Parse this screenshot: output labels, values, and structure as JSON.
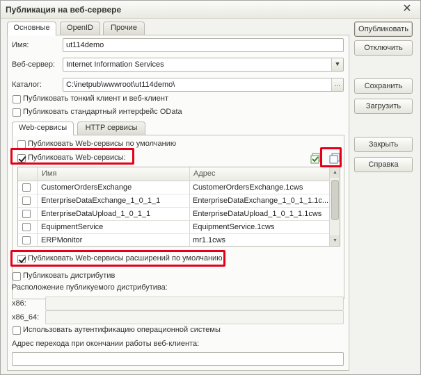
{
  "window": {
    "title": "Публикация на веб-сервере",
    "close_icon": "close-icon"
  },
  "tabs": [
    {
      "label": "Основные",
      "active": true
    },
    {
      "label": "OpenID",
      "active": false
    },
    {
      "label": "Прочие",
      "active": false
    }
  ],
  "form": {
    "name_label": "Имя:",
    "name_value": "ut114demo",
    "webserver_label": "Веб-сервер:",
    "webserver_value": "Internet Information Services",
    "catalog_label": "Каталог:",
    "catalog_value": "C:\\inetpub\\wwwroot\\ut114demo\\",
    "catalog_btn": "...",
    "publish_thin_client": "Публиковать тонкий клиент и веб-клиент",
    "publish_odata": "Публиковать стандартный интерфейс OData"
  },
  "inner_tabs": [
    {
      "label": "Web-сервисы",
      "active": true
    },
    {
      "label": "HTTP сервисы",
      "active": false
    }
  ],
  "webservices": {
    "publish_default": "Публиковать Web-сервисы по умолчанию",
    "publish_ws": "Публиковать Web-сервисы:",
    "columns": [
      "Имя",
      "Адрес"
    ],
    "rows": [
      {
        "name": "CustomerOrdersExchange",
        "address": "CustomerOrdersExchange.1cws",
        "checked": false
      },
      {
        "name": "EnterpriseDataExchange_1_0_1_1",
        "address": "EnterpriseDataExchange_1_0_1_1.1c...",
        "checked": false
      },
      {
        "name": "EnterpriseDataUpload_1_0_1_1",
        "address": "EnterpriseDataUpload_1_0_1_1.1cws",
        "checked": false
      },
      {
        "name": "EquipmentService",
        "address": "EquipmentService.1cws",
        "checked": false
      },
      {
        "name": "ERPMonitor",
        "address": "mr1.1cws",
        "checked": false
      }
    ],
    "publish_ext_default": "Публиковать Web-сервисы расширений по умолчанию"
  },
  "distributive": {
    "publish_dist": "Публиковать дистрибутив",
    "location_label": "Расположение публикуемого дистрибутива:",
    "x86_label": "x86:",
    "x86_64_label": "x86_64:",
    "use_os_auth": "Использовать аутентификацию операционной системы",
    "redirect_label": "Адрес перехода при окончании работы веб-клиента:"
  },
  "buttons": {
    "publish": "Опубликовать",
    "disable": "Отключить",
    "save": "Сохранить",
    "load": "Загрузить",
    "close": "Закрыть",
    "help": "Справка"
  },
  "colors": {
    "highlight_red": "#e4001b"
  }
}
